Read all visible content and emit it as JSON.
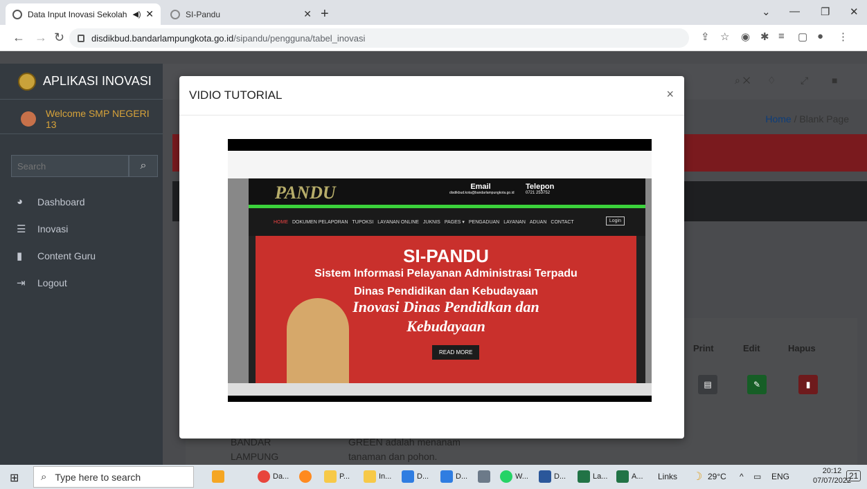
{
  "browser": {
    "tabs": [
      {
        "title": "Data Input Inovasi Sekolah",
        "active": true
      },
      {
        "title": "SI-Pandu",
        "active": false
      }
    ],
    "url_host": "disdikbud.bandarlampungkota.go.id",
    "url_path": "/sipandu/pengguna/tabel_inovasi"
  },
  "sidebar": {
    "brand": "APLIKASI INOVASI",
    "welcome": "Welcome SMP NEGERI 13",
    "search_placeholder": "Search",
    "items": [
      {
        "label": "Dashboard",
        "icon": "dashboard-icon"
      },
      {
        "label": "Inovasi",
        "icon": "database-icon"
      },
      {
        "label": "Content Guru",
        "icon": "file-icon"
      },
      {
        "label": "Logout",
        "icon": "logout-icon"
      }
    ]
  },
  "breadcrumb": {
    "home": "Home",
    "separator": "/",
    "current": "Blank Page"
  },
  "table": {
    "headers": [
      "Print",
      "Edit",
      "Hapus"
    ],
    "row_text_left": [
      "BANDAR",
      "LAMPUNG"
    ],
    "row_text_mid": [
      "GREEN adalah menanam",
      "tanaman dan pohon."
    ]
  },
  "modal": {
    "title": "VIDIO TUTORIAL",
    "close": "×"
  },
  "video": {
    "logo": "PANDU",
    "email_label": "Email",
    "email_value": "disdikbud.kota@bandarlampungkota.go.id",
    "phone_label": "Telepon",
    "phone_value": "0721 253752",
    "nav_items": [
      "HOME",
      "DOKUMEN PELAPORAN",
      "TUPOKSI",
      "LAYANAN ONLINE",
      "JUKNIS",
      "PAGES ▾",
      "PENGADUAN",
      "LAYANAN",
      "ADUAN",
      "CONTACT"
    ],
    "login": "Login",
    "banner_title": "SI-PANDU",
    "banner_sub": "Sistem Informasi Pelayanan Administrasi Terpadu",
    "banner_line1": "Dinas Pendidikan dan Kebudayaan",
    "banner_line2": "Inovasi Dinas Pendidkan dan",
    "banner_line3": "Kebudayaan",
    "read_more": "READ MORE"
  },
  "taskbar": {
    "search_placeholder": "Type here to search",
    "apps": [
      "Da...",
      "P...",
      "In...",
      "D...",
      "D...",
      "W...",
      "D...",
      "La...",
      "A..."
    ],
    "links": "Links",
    "temp": "29°C",
    "lang": "ENG",
    "time": "20:12",
    "date": "07/07/2022",
    "notif_count": "21"
  },
  "colors": {
    "sidebar_bg": "#343a40",
    "welcome": "#d7a33a",
    "danger": "#c9302c",
    "success": "#28a745"
  }
}
